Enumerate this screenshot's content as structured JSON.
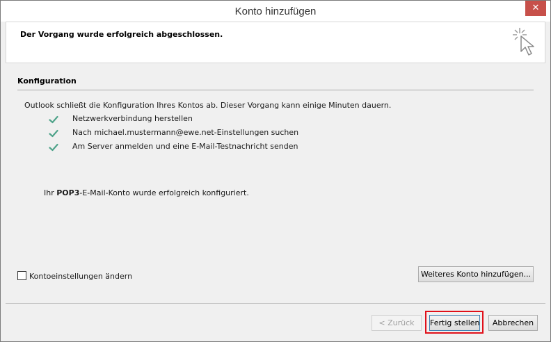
{
  "window": {
    "title": "Konto hinzufügen",
    "close_glyph": "✕"
  },
  "header": {
    "text": "Der Vorgang wurde erfolgreich abgeschlossen.",
    "icon": "cursor-sparkle-icon"
  },
  "config": {
    "section_title": "Konfiguration",
    "intro": "Outlook schließt die Konfiguration Ihres Kontos ab. Dieser Vorgang kann einige Minuten dauern.",
    "steps": [
      {
        "label": "Netzwerkverbindung herstellen",
        "status": "done"
      },
      {
        "label": "Nach michael.mustermann@ewe.net-Einstellungen suchen",
        "status": "done"
      },
      {
        "label": "Am Server anmelden und eine E-Mail-Testnachricht senden",
        "status": "done"
      }
    ],
    "result_prefix": "Ihr ",
    "result_bold": "POP3",
    "result_suffix": "-E-Mail-Konto wurde erfolgreich konfiguriert."
  },
  "options": {
    "change_settings_label": "Kontoeinstellungen ändern",
    "change_settings_checked": false,
    "add_account_label": "Weiteres Konto hinzufügen..."
  },
  "footer": {
    "back_label": "< Zurück",
    "finish_label": "Fertig stellen",
    "cancel_label": "Abbrechen"
  },
  "colors": {
    "check": "#4fa38a",
    "highlight": "#e0101a",
    "close_button": "#c7504a"
  }
}
